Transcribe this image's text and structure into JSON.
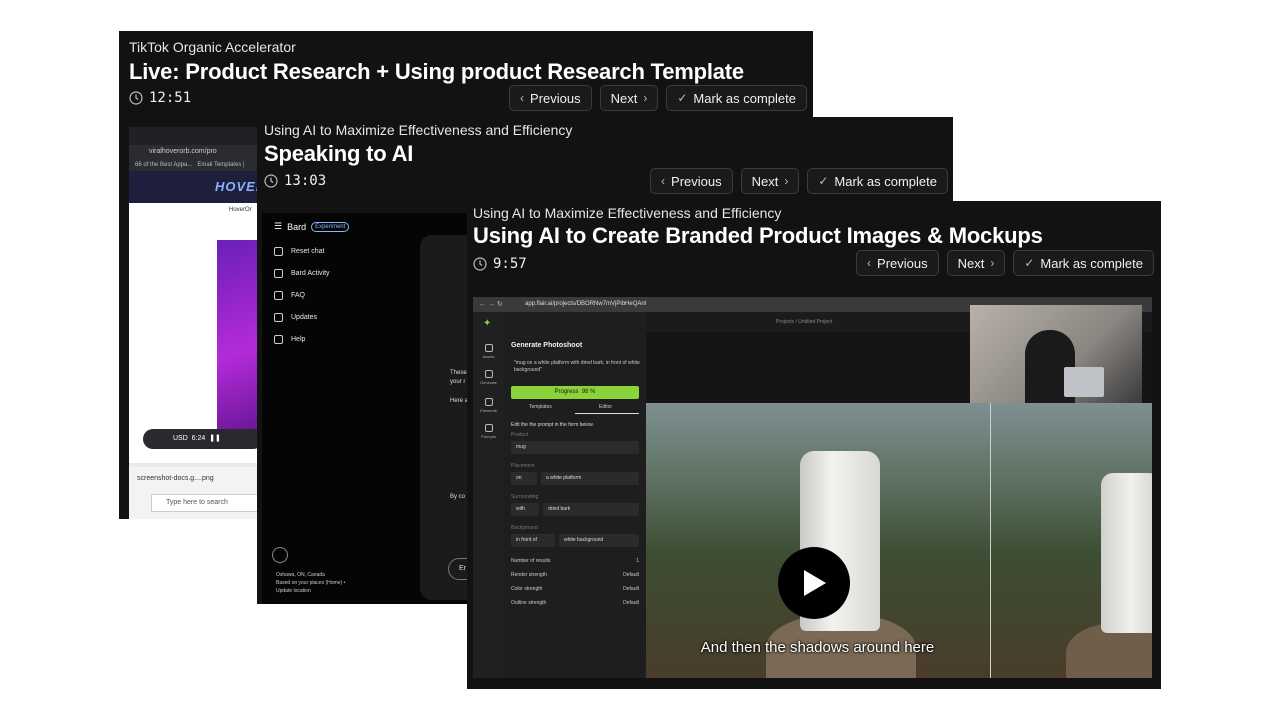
{
  "cards": [
    {
      "course": "TikTok Organic Accelerator",
      "title": "Live: Product Research + Using product Research Template",
      "duration": "12:51",
      "previous_label": "Previous",
      "next_label": "Next",
      "complete_label": "Mark as complete",
      "video": {
        "address": "viralhoverorb.com/pro",
        "bookmark_1": "66 of the Best Appa...",
        "bookmark_2": "Email Templates |",
        "site_logo": "HOVER",
        "breadcrumb": "HoverOr",
        "currency": "USD",
        "time": "6:24",
        "download": "screenshot-docs.g....png",
        "search_placeholder": "Type here to search"
      }
    },
    {
      "course": "Using AI to Maximize Effectiveness and Efficiency",
      "title": "Speaking to AI",
      "duration": "13:03",
      "previous_label": "Previous",
      "next_label": "Next",
      "complete_label": "Mark as complete",
      "video": {
        "app_name": "Bard",
        "badge": "Experiment",
        "menu": [
          "Reset chat",
          "Bard Activity",
          "FAQ",
          "Updates",
          "Help"
        ],
        "location": "Oshawa, ON, Canada",
        "location_sub": "Based on your places (Home) •",
        "location_update": "Update location",
        "text_1": "These",
        "text_2": "your r",
        "text_3": "Here a",
        "text_4": "By co",
        "button": "Er"
      }
    },
    {
      "course": "Using AI to Maximize Effectiveness and Efficiency",
      "title": "Using AI to Create Branded Product Images & Mockups",
      "duration": "9:57",
      "previous_label": "Previous",
      "next_label": "Next",
      "complete_label": "Mark as complete",
      "video": {
        "address": "app.flair.ai/projects/DBORNw7mVjPibHeQAnl",
        "project_path": "Projects / Untitled Project",
        "rail": [
          "Assets",
          "Generate",
          "Elements",
          "Prompts"
        ],
        "panel_title": "Generate Photoshoot",
        "prompt": "\"mug on a white platform with dried bark, in front of white background\"",
        "progress_label": "Progress",
        "progress_value": "98 %",
        "tab_templates": "Templates",
        "tab_editor": "Editor",
        "hint": "Edit the the prompt in the form below.",
        "product_label": "Product",
        "product_value": "mug",
        "placement_label": "Placement",
        "placement_prep": "on",
        "placement_value": "a white platform",
        "surrounding_label": "Surrounding",
        "surrounding_prep": "with",
        "surrounding_value": "dried bark",
        "background_label": "Background",
        "background_prep": "in front of",
        "background_value": "white background",
        "num_results_label": "Number of results",
        "num_results_value": "1",
        "render_label": "Render strength",
        "render_value": "Default",
        "color_label": "Color strength",
        "color_value": "Default",
        "outline_label": "Outline strength",
        "outline_value": "Default",
        "caption": "And then the shadows around here"
      }
    }
  ],
  "colors": {
    "card_bg": "#121212",
    "progress": "#8bd33a",
    "button_border": "#3c3c3c"
  }
}
